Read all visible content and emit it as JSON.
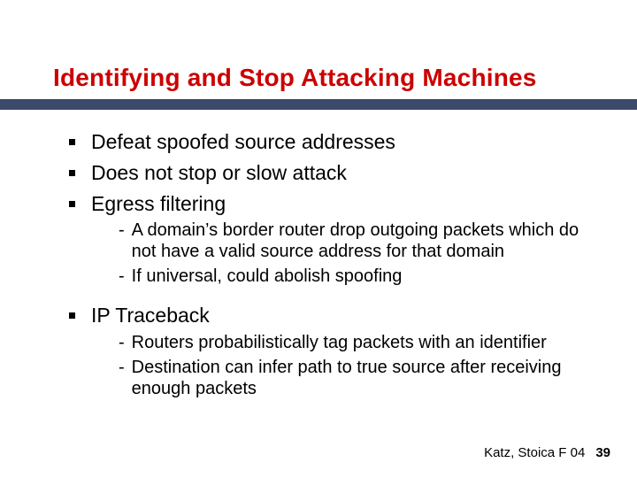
{
  "title": "Identifying and Stop Attacking Machines",
  "bullets": {
    "b1": "Defeat spoofed source addresses",
    "b2": "Does not stop or slow attack",
    "b3": "Egress filtering",
    "b3_sub1": "A domain’s border router drop outgoing packets which do not have a valid source address for that domain",
    "b3_sub2": "If universal, could abolish spoofing",
    "b4": "IP Traceback",
    "b4_sub1": "Routers probabilistically tag packets with an identifier",
    "b4_sub2": "Destination can infer path to true source after receiving enough packets"
  },
  "footer": {
    "credit": "Katz, Stoica F 04",
    "page": "39"
  }
}
